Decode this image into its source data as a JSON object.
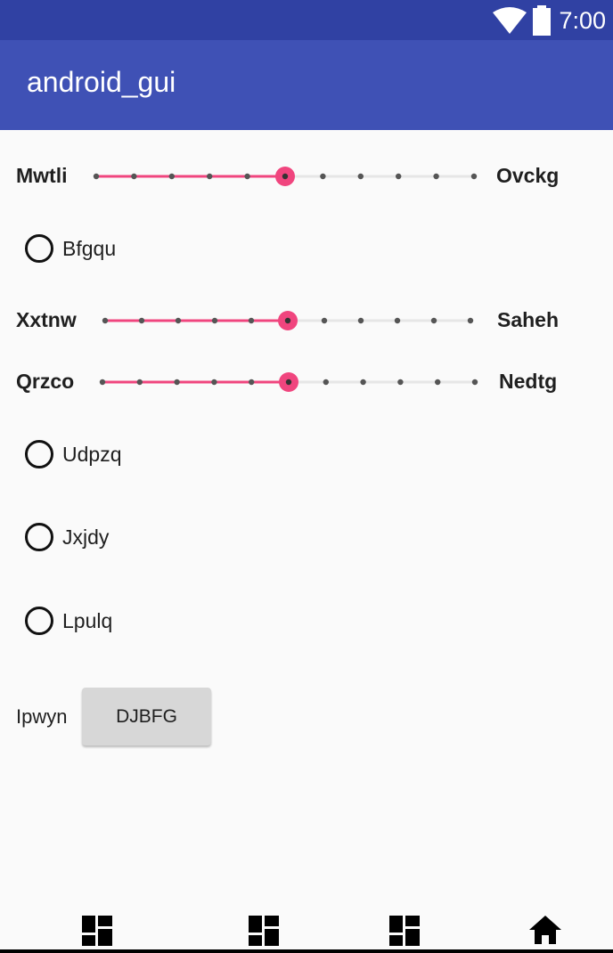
{
  "status_bar": {
    "time": "7:00",
    "icons": [
      "wifi-icon",
      "battery-icon"
    ]
  },
  "app_bar": {
    "title": "android_gui"
  },
  "colors": {
    "status_bar": "#3041a3",
    "app_bar": "#3f51b5",
    "accent": "#f0457e"
  },
  "sliders": [
    {
      "left_label": "Mwtli",
      "right_label": "Ovckg",
      "value": 5,
      "max": 10
    },
    {
      "left_label": "Xxtnw",
      "right_label": "Saheh",
      "value": 5,
      "max": 10
    },
    {
      "left_label": "Qrzco",
      "right_label": "Nedtg",
      "value": 5,
      "max": 10
    }
  ],
  "radios": [
    {
      "label": "Bfgqu",
      "checked": false
    },
    {
      "label": "Udpzq",
      "checked": false
    },
    {
      "label": "Jxjdy",
      "checked": false
    },
    {
      "label": "Lpulq",
      "checked": false
    }
  ],
  "button_row": {
    "label": "Ipwyn",
    "button_label": "DJBFG"
  },
  "bottom_nav": {
    "icons": [
      "dashboard-icon",
      "dashboard-icon",
      "dashboard-icon",
      "home-icon"
    ]
  }
}
